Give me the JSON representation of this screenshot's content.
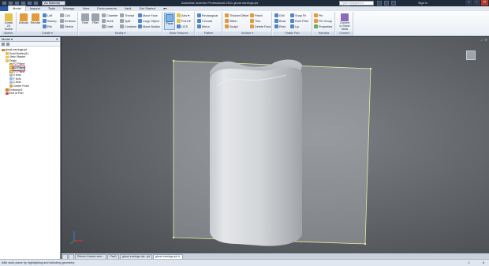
{
  "titlebar": {
    "material": "As Material",
    "title": "Autodesk Inventor Professional 2011   ghost earrings.ipt",
    "search_placeholder": "Type a keyword or phrase",
    "signin": "Sign In",
    "min": "–",
    "max": "▫",
    "close": "✕"
  },
  "tabs": [
    "Model",
    "Inspect",
    "Tools",
    "Manage",
    "View",
    "Environments",
    "Vault",
    "Get Started",
    "●▾"
  ],
  "ribbon": {
    "sketch": {
      "title": "Sketch",
      "create_2d": "Create 2D Sketch"
    },
    "create": {
      "title": "Create ▾",
      "extrude": "Extrude",
      "revolve": "Revolve",
      "loft": "Loft",
      "sweep": "Sweep",
      "rib": "Rib",
      "coil": "Coil",
      "emboss": "Emboss",
      "derive": "Derive"
    },
    "modify": {
      "title": "Modify ▾",
      "hole": "Hole",
      "fillet": "Fillet",
      "chamfer": "Chamfer",
      "shell": "Shell",
      "draft": "Draft",
      "thread": "Thread",
      "split": "Split",
      "combine": "Combine",
      "move_face": "Move Face",
      "copy_object": "Copy Object",
      "move_bodies": "Move Bodies"
    },
    "work_features": {
      "title": "Work Features",
      "plane": "Plane",
      "axis": "Axis ▾",
      "point": "Point ▾",
      "ucs": "UCS"
    },
    "pattern": {
      "title": "Pattern",
      "rectangular": "Rectangular",
      "circular": "Circular",
      "mirror": "Mirror"
    },
    "surface": {
      "title": "Surface ▾",
      "thicken": "Thicken/Offset",
      "stitch": "Stitch",
      "sculpt": "Sculpt",
      "patch": "Patch",
      "trim": "Trim",
      "delete_face": "Delete Face"
    },
    "plastic": {
      "title": "Plastic Part",
      "grill": "Grill",
      "boss": "Boss",
      "rest": "Rest",
      "snap_fit": "Snap Fit",
      "rule_fillet": "Rule Fillet",
      "lip": "Lip"
    },
    "harness": {
      "title": "Harness",
      "pin": "Pin",
      "pin_group": "Pin Group",
      "properties": "Properties"
    },
    "convert": {
      "title": "Convert",
      "to_sheet": "Convert to Sheet Metal"
    }
  },
  "browser": {
    "title": "Model ▾",
    "close": "✕",
    "nodes": [
      {
        "label": "ghost earrings.ipt",
        "icon": "part-icon",
        "indent": 0
      },
      {
        "label": "Solid Bodies(1)",
        "icon": "folder-icon",
        "indent": 1
      },
      {
        "label": "View: Master",
        "icon": "folder-icon",
        "indent": 1
      },
      {
        "label": "Origin",
        "icon": "folder-icon",
        "indent": 1
      },
      {
        "label": "YZ Plane",
        "icon": "plane-icon",
        "indent": 2
      },
      {
        "label": "XZ Plane",
        "icon": "plane-icon",
        "indent": 2,
        "selected": true
      },
      {
        "label": "XY Plane",
        "icon": "plane-icon",
        "indent": 2
      },
      {
        "label": "X Axis",
        "icon": "axis-icon",
        "indent": 2
      },
      {
        "label": "Y Axis",
        "icon": "axis-icon",
        "indent": 2
      },
      {
        "label": "Z Axis",
        "icon": "axis-icon",
        "indent": 2
      },
      {
        "label": "Center Point",
        "icon": "point-icon",
        "indent": 2
      },
      {
        "label": "Extrusion1",
        "icon": "feature-icon",
        "indent": 1
      },
      {
        "label": "End of Part",
        "icon": "end-icon",
        "indent": 1
      }
    ]
  },
  "doctabs": [
    "Rinnen Kasten sem...",
    "Part1",
    "ghost earrings dw...ipt",
    "ghost earrings.ipt ✕"
  ],
  "status": {
    "text": "Affix work plane by highlighting and selecting geometry",
    "num1": "1",
    "num2": "6"
  },
  "viewport": {
    "minmax": "– ▫ ✕"
  },
  "colors": {
    "ribbon_accent": "#2b58a3",
    "selection": "#e05050",
    "plane_preview": "#e8ee9a"
  }
}
